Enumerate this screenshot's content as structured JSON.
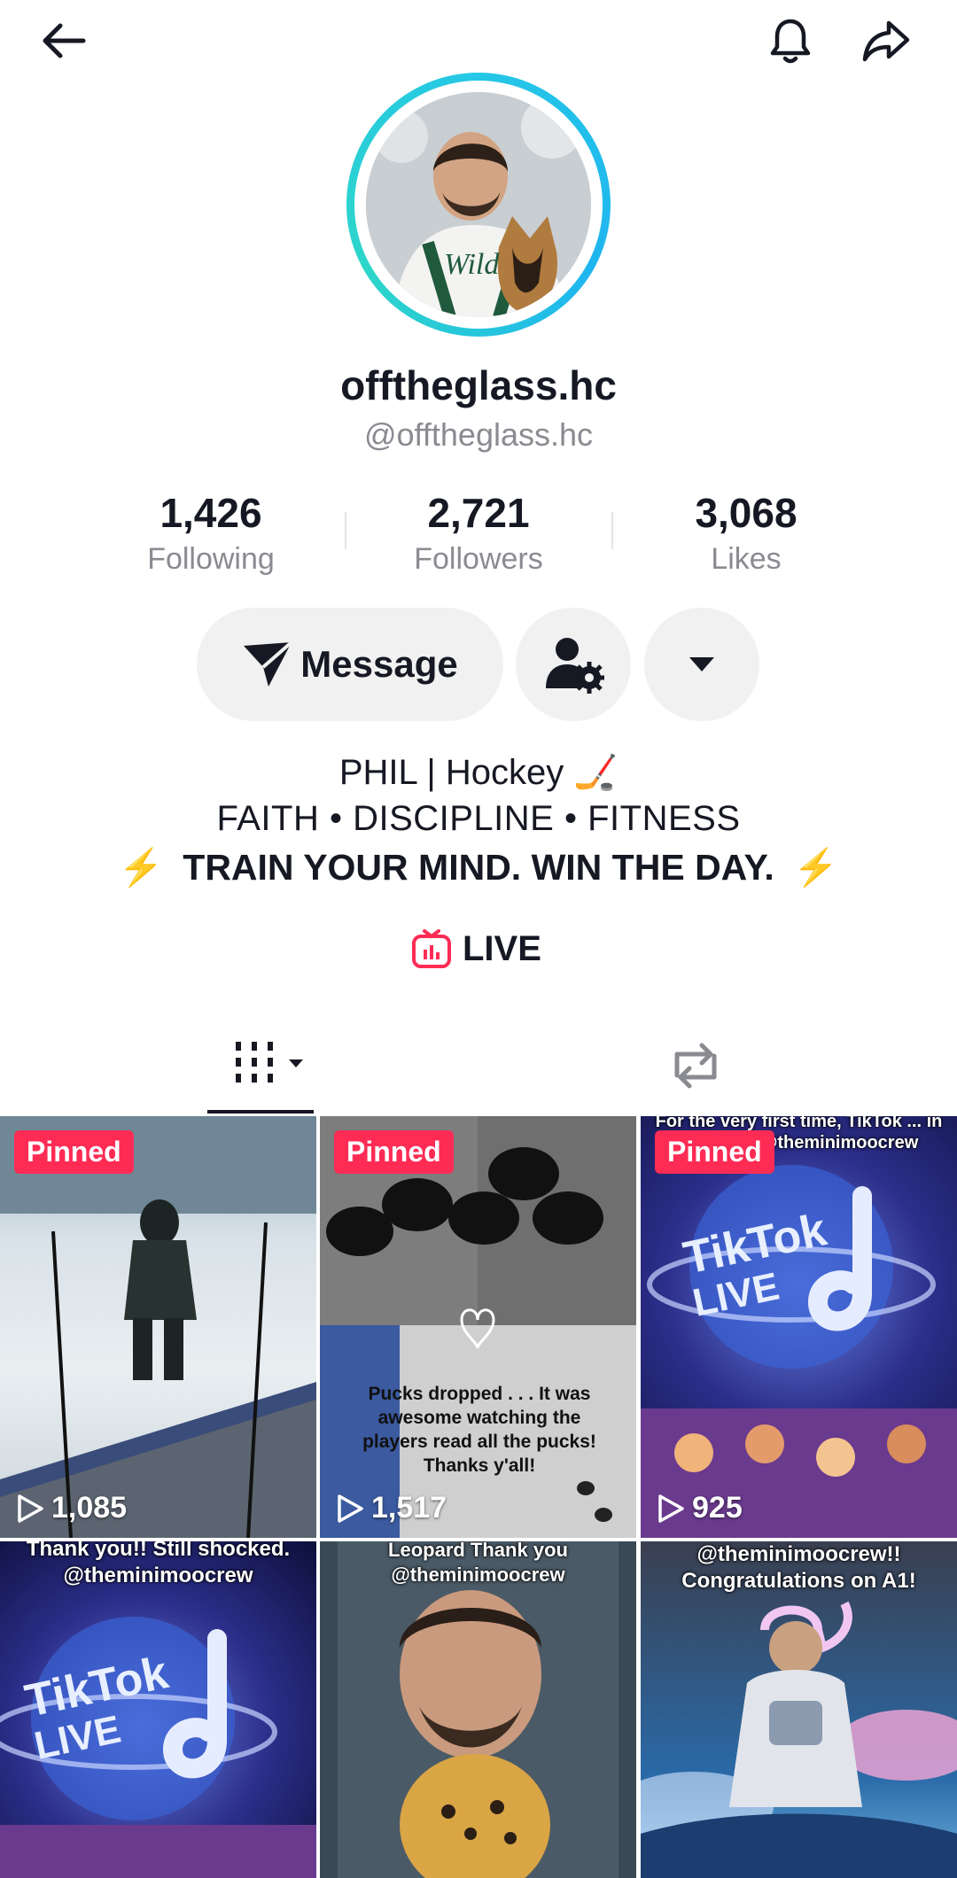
{
  "header": {
    "back_icon": "arrow-left-icon",
    "bell_icon": "bell-icon",
    "share_icon": "share-arrow-icon"
  },
  "profile": {
    "display_name": "offtheglass.hc",
    "handle": "@offtheglass.hc",
    "ring_color": "#25c7e6"
  },
  "stats": [
    {
      "value": "1,426",
      "label": "Following"
    },
    {
      "value": "2,721",
      "label": "Followers"
    },
    {
      "value": "3,068",
      "label": "Likes"
    }
  ],
  "actions": {
    "message_label": "Message"
  },
  "bio": {
    "line1": "PHIL | Hockey 🏒",
    "line2": "FAITH • DISCIPLINE • FITNESS",
    "line3": "TRAIN YOUR MIND. WIN THE DAY.",
    "bolt": "⚡"
  },
  "live": {
    "label": "LIVE",
    "color": "#fe2c55"
  },
  "tabs": {
    "videos_icon": "grid-videos-icon",
    "reposts_icon": "repost-icon"
  },
  "videos": [
    {
      "pinned": "Pinned",
      "views": "1,085"
    },
    {
      "pinned": "Pinned",
      "views": "1,517",
      "caption": "Pucks dropped . . . It was awesome watching the players read all the pucks! Thanks y'all!"
    },
    {
      "pinned": "Pinned",
      "views": "925",
      "caption_top": "For the very first time, TikTok ... in my LIVE! @theminimoocrew"
    },
    {
      "caption_top": "Thank you!! Still shocked. @theminimoocrew"
    },
    {
      "caption_top": "Leopard Thank you @theminimoocrew"
    },
    {
      "caption_top": "@theminimoocrew!! Congratulations on A1!"
    }
  ],
  "pinned_color": "#fe2c55"
}
